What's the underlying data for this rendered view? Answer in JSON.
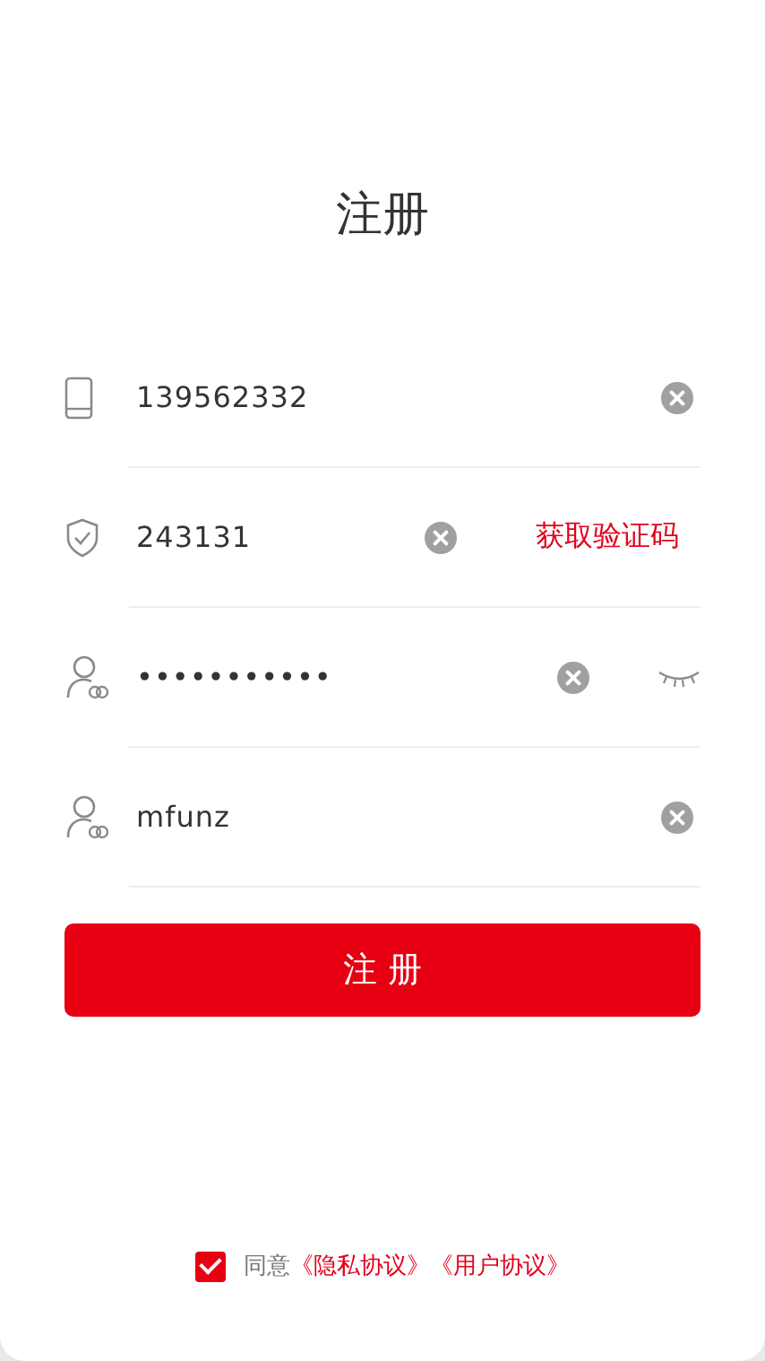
{
  "title": "注册",
  "fields": [
    {
      "kind": "phone",
      "value": "139562332"
    },
    {
      "kind": "code",
      "value": "243131",
      "action": "获取验证码"
    },
    {
      "kind": "password",
      "value": "•••••••••••",
      "eye_visible": false
    },
    {
      "kind": "user",
      "value": "mfunz"
    }
  ],
  "submit": "注 册",
  "agreement": {
    "checked": true,
    "prefix": "同意",
    "links": [
      "《隐私协议》",
      "《用户协议》"
    ]
  }
}
